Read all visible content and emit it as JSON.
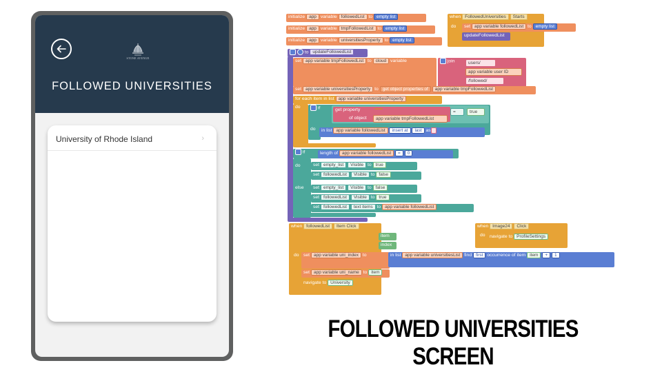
{
  "phone": {
    "page_title": "FOLLOWED UNIVERSITIES",
    "logo_text": "STONE AVENUE",
    "list": [
      {
        "label": "University of Rhode Island",
        "chevron": "›"
      }
    ],
    "icons": {
      "back": "back-arrow-circle-icon",
      "logo": "ship-logo-icon"
    }
  },
  "blocks": {
    "init1": {
      "a": "initialize",
      "b": "app",
      "c": "variable",
      "d": "followedList",
      "e": "to",
      "f": "empty list"
    },
    "init2": {
      "a": "initialize",
      "b": "app",
      "c": "variable",
      "d": "tmpFollowedList",
      "e": "to",
      "f": "empty list"
    },
    "init3": {
      "a": "initialize",
      "b": "app",
      "c": "variable",
      "d": "universitiesProperty",
      "e": "to",
      "f": "empty list"
    },
    "starts": {
      "when": "when",
      "comp": "FollowedUniversities",
      "event": "Starts",
      "do": "do",
      "set": "set",
      "var": "app variable followedList",
      "to": "to",
      "val": "empty list",
      "call": "updateFollowedList"
    },
    "proc": {
      "to": "to",
      "name": "updateFollowedList"
    },
    "s1": {
      "set": "set",
      "var": "app variable tmpFollowedList",
      "to": "to",
      "cloud": "cloud",
      "variable": "variable",
      "join": "join",
      "q1": "users/",
      "uid": "app variable user ID",
      "q2": "/followed/"
    },
    "s2": {
      "set": "set",
      "var": "app variable universitiesProperty",
      "to": "to",
      "getp": "get object properties of",
      "arg": "app variable tmpFollowedList"
    },
    "fe": {
      "label": "for each item",
      "inlist": "in list",
      "list": "app variable universitiesProperty",
      "do": "do",
      "if": "if",
      "getprop": "get property",
      "ofobj": "of object",
      "obj": "app variable tmpFollowedList",
      "eq": "=",
      "true": "true",
      "do2": "do",
      "inlist2": "in list",
      "list2": "app variable followedList",
      "insert": "insert at",
      "last": "last",
      "as": "as"
    },
    "if2": {
      "if": "if",
      "length": "length of",
      "arg": "app variable followedList",
      "eq": "=",
      "zero": "0",
      "do": "do",
      "else": "else",
      "rows": [
        {
          "set": "set",
          "comp": "empty_list",
          "prop": "Visible",
          "to": "to",
          "val": "true"
        },
        {
          "set": "set",
          "comp": "followedList",
          "prop": "Visible",
          "to": "to",
          "val": "false"
        },
        {
          "set": "set",
          "comp": "empty_list",
          "prop": "Visible",
          "to": "to",
          "val": "false"
        },
        {
          "set": "set",
          "comp": "followedList",
          "prop": "Visible",
          "to": "to",
          "val": "true"
        },
        {
          "set": "set",
          "comp": "followedList",
          "prop": "text items",
          "to": "to",
          "val": "app variable followedList"
        }
      ]
    },
    "click": {
      "when": "when",
      "comp": "followedList",
      "event": "Item Click",
      "item": "item",
      "index": "index",
      "do": "do",
      "set1": "set",
      "var1": "app variable uni_index",
      "to": "to",
      "inlist": "in list",
      "list": "app variable universitiesList",
      "find": "find",
      "first": "first",
      "occ": "occurrence of item",
      "item2": "item",
      "op": "+",
      "one": "1",
      "set2": "set",
      "var2": "app variable uni_name",
      "to2": "to",
      "item3": "item",
      "nav": "navigate to",
      "screen": "University"
    },
    "img": {
      "when": "when",
      "comp": "Image24",
      "event": "Click",
      "do": "do",
      "nav": "navigate to",
      "screen": "ProfileSettings"
    }
  },
  "caption": "FOLLOWED UNIVERSITIES SCREEN"
}
